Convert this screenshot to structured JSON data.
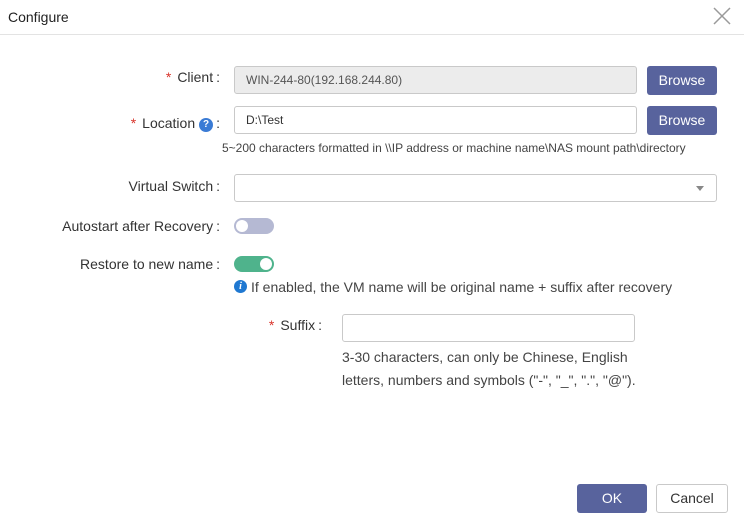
{
  "dialog": {
    "title": "Configure"
  },
  "client": {
    "label": "Client",
    "value": "WIN-244-80(192.168.244.80)",
    "browse": "Browse"
  },
  "location": {
    "label": "Location",
    "help_glyph": "?",
    "value": "D:\\Test",
    "browse": "Browse",
    "hint": "5~200 characters formatted in \\\\IP address or machine name\\NAS mount path\\directory"
  },
  "virtual_switch": {
    "label": "Virtual Switch",
    "value": ""
  },
  "autostart": {
    "label": "Autostart after Recovery",
    "enabled": false
  },
  "restore_new_name": {
    "label": "Restore to new name",
    "enabled": true,
    "info": "If enabled, the VM name will be original name + suffix after recovery"
  },
  "suffix": {
    "label": "Suffix",
    "value": "",
    "hint": "3-30 characters, can only be Chinese, English letters, numbers and symbols (\"-\", \"_\", \".\", \"@\")."
  },
  "footer": {
    "ok": "OK",
    "cancel": "Cancel"
  },
  "colors": {
    "primary": "#58639d",
    "toggle_on": "#4fb38c",
    "toggle_off": "#b5b9d3",
    "required": "#d9342b",
    "info": "#1f78d1"
  },
  "icons": {
    "close": "close-icon",
    "help": "help-icon",
    "info": "info-icon",
    "dropdown": "chevron-down-icon"
  }
}
